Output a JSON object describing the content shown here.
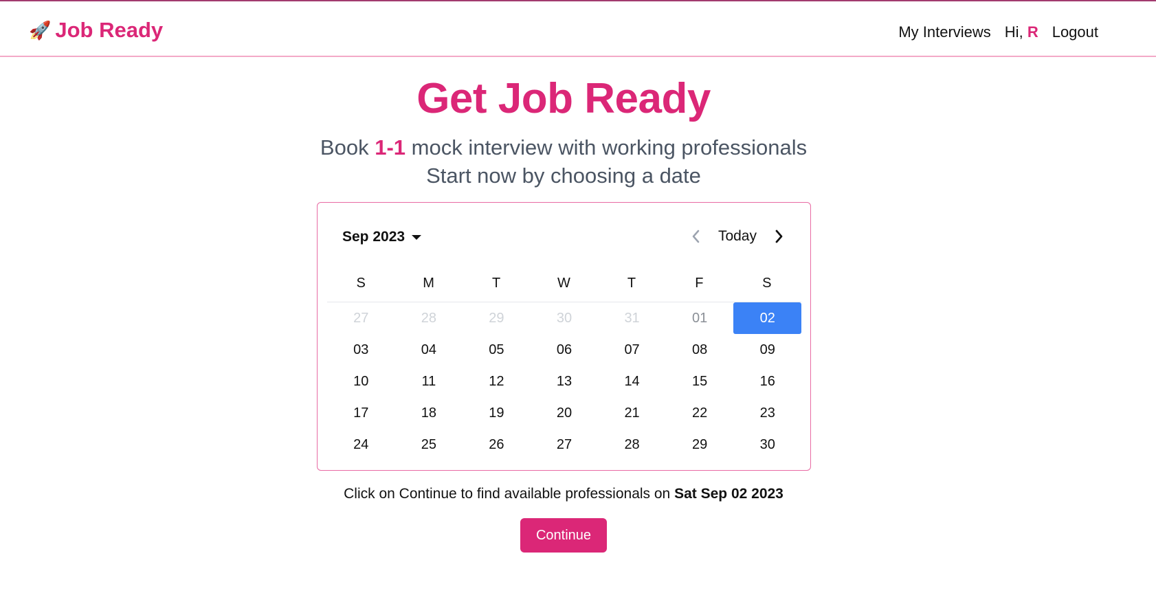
{
  "header": {
    "brand_icon": "rocket-icon",
    "brand": "Job Ready",
    "nav": {
      "my_interviews": "My Interviews",
      "greeting": "Hi,",
      "user_initial": "R",
      "logout": "Logout"
    }
  },
  "hero": {
    "title": "Get Job Ready",
    "line1_prefix": "Book",
    "line1_highlight": "1-1",
    "line1_suffix": "mock interview with working professionals",
    "line2": "Start now by choosing a date"
  },
  "calendar": {
    "month_label": "Sep 2023",
    "today_label": "Today",
    "weekdays": [
      "S",
      "M",
      "T",
      "W",
      "T",
      "F",
      "S"
    ],
    "selected": "02",
    "days": [
      {
        "label": "27",
        "state": "muted"
      },
      {
        "label": "28",
        "state": "muted"
      },
      {
        "label": "29",
        "state": "muted"
      },
      {
        "label": "30",
        "state": "muted"
      },
      {
        "label": "31",
        "state": "muted"
      },
      {
        "label": "01",
        "state": "dim"
      },
      {
        "label": "02",
        "state": "selected"
      },
      {
        "label": "03",
        "state": "normal"
      },
      {
        "label": "04",
        "state": "normal"
      },
      {
        "label": "05",
        "state": "normal"
      },
      {
        "label": "06",
        "state": "normal"
      },
      {
        "label": "07",
        "state": "normal"
      },
      {
        "label": "08",
        "state": "normal"
      },
      {
        "label": "09",
        "state": "normal"
      },
      {
        "label": "10",
        "state": "normal"
      },
      {
        "label": "11",
        "state": "normal"
      },
      {
        "label": "12",
        "state": "normal"
      },
      {
        "label": "13",
        "state": "normal"
      },
      {
        "label": "14",
        "state": "normal"
      },
      {
        "label": "15",
        "state": "normal"
      },
      {
        "label": "16",
        "state": "normal"
      },
      {
        "label": "17",
        "state": "normal"
      },
      {
        "label": "18",
        "state": "normal"
      },
      {
        "label": "19",
        "state": "normal"
      },
      {
        "label": "20",
        "state": "normal"
      },
      {
        "label": "21",
        "state": "normal"
      },
      {
        "label": "22",
        "state": "normal"
      },
      {
        "label": "23",
        "state": "normal"
      },
      {
        "label": "24",
        "state": "normal"
      },
      {
        "label": "25",
        "state": "normal"
      },
      {
        "label": "26",
        "state": "normal"
      },
      {
        "label": "27",
        "state": "normal"
      },
      {
        "label": "28",
        "state": "normal"
      },
      {
        "label": "29",
        "state": "normal"
      },
      {
        "label": "30",
        "state": "normal"
      }
    ]
  },
  "footer": {
    "hint_prefix": "Click on Continue to find available professionals on",
    "selected_date": "Sat Sep 02 2023",
    "continue_label": "Continue"
  },
  "colors": {
    "brand": "#db2777",
    "selected_day": "#3b82f6",
    "muted_day": "#cfd3d8"
  }
}
